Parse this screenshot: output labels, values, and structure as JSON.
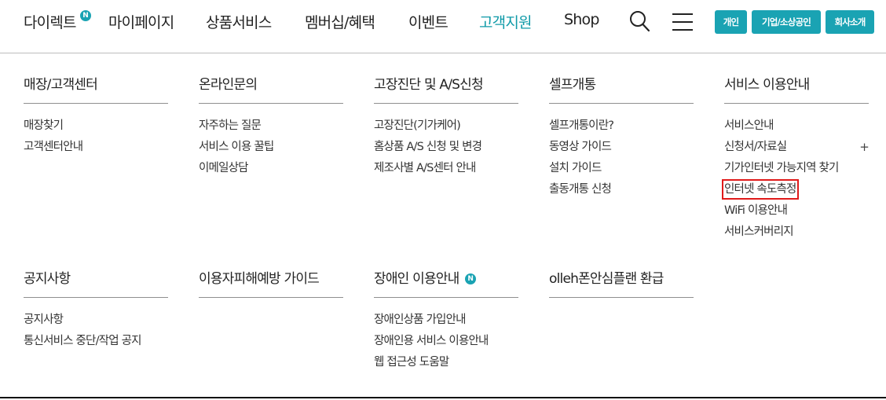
{
  "header": {
    "nav": [
      {
        "label": "다이렉트",
        "badge": "N"
      },
      {
        "label": "마이페이지"
      },
      {
        "label": "상품서비스"
      },
      {
        "label": "멤버십/혜택"
      },
      {
        "label": "이벤트"
      },
      {
        "label": "고객지원",
        "active": true
      },
      {
        "label": "Shop"
      }
    ],
    "icons": [
      "search-icon",
      "menu-icon"
    ],
    "pills": [
      "개인",
      "기업/소상공인",
      "회사소개"
    ],
    "accent_color": "#1aa3b3",
    "active_color": "#0f9aa8"
  },
  "menu": {
    "columns": [
      {
        "title": "매장/고객센터",
        "links": [
          "매장찾기",
          "고객센터안내"
        ]
      },
      {
        "title": "온라인문의",
        "links": [
          "자주하는 질문",
          "서비스 이용 꿀팁",
          "이메일상담"
        ]
      },
      {
        "title": "고장진단 및 A/S신청",
        "links": [
          "고장진단(기가케어)",
          "홈상품 A/S 신청 및 변경",
          "제조사별 A/S센터 안내"
        ]
      },
      {
        "title": "셀프개통",
        "links": [
          "셀프개통이란?",
          "동영상 가이드",
          "설치 가이드",
          "출동개통 신청"
        ]
      },
      {
        "title": "서비스 이용안내",
        "links": [
          "서비스안내",
          "신청서/자료실",
          "기가인터넷 가능지역 찾기",
          "인터넷 속도측정",
          "WiFi 이용안내",
          "서비스커버리지"
        ],
        "expand_symbol": "+",
        "highlighted_link": "인터넷 속도측정"
      },
      {
        "title": "공지사항",
        "links": [
          "공지사항",
          "통신서비스 중단/작업 공지"
        ]
      },
      {
        "title": "이용자피해예방 가이드",
        "links": []
      },
      {
        "title": "장애인 이용안내",
        "badge": "N",
        "links": [
          "장애인상품 가입안내",
          "장애인용 서비스 이용안내",
          "웹 접근성 도움말"
        ]
      },
      {
        "title": "olleh폰안심플랜 환급",
        "links": []
      }
    ],
    "highlight_color": "#e01a1a"
  }
}
